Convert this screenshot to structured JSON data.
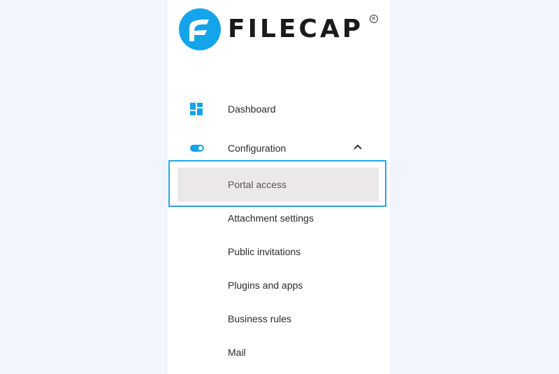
{
  "brand": {
    "name": "FILECAP",
    "registered_mark": "R",
    "logo_color": "#13a4ec",
    "icon": "filecap-logo-icon"
  },
  "colors": {
    "page_background": "#f1f5fd",
    "panel_background": "#ffffff",
    "accent": "#13a4ec",
    "selected_background": "#ebe8ea",
    "highlight_border": "#2aa6dc"
  },
  "nav": {
    "dashboard": {
      "label": "Dashboard",
      "icon": "dashboard-grid-icon"
    },
    "configuration": {
      "label": "Configuration",
      "icon": "toggle-icon",
      "expanded": true,
      "chevron": "chevron-up-icon",
      "items": [
        {
          "label": "Portal access",
          "selected": true
        },
        {
          "label": "Attachment settings"
        },
        {
          "label": "Public invitations"
        },
        {
          "label": "Plugins and apps"
        },
        {
          "label": "Business rules"
        },
        {
          "label": "Mail"
        }
      ]
    }
  }
}
